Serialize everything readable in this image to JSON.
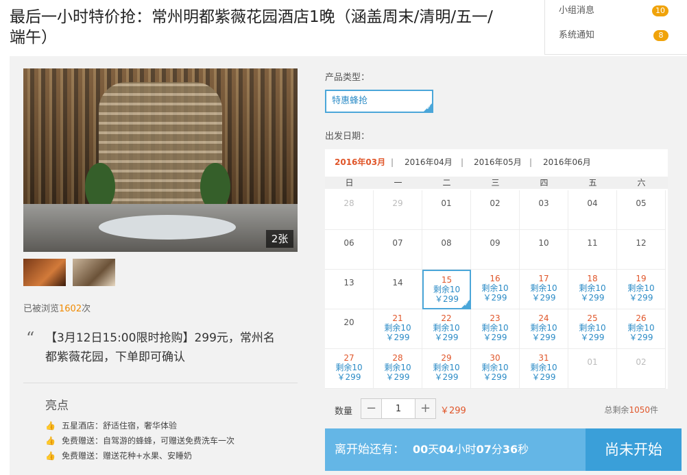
{
  "page": {
    "title": "最后一小时特价抢：常州明都紫薇花园酒店1晚（涵盖周末/清明/五一/端午）"
  },
  "notifications": [
    {
      "label": "小组消息",
      "count": "10"
    },
    {
      "label": "系统通知",
      "count": "8"
    }
  ],
  "gallery": {
    "count_label": "2张",
    "views_prefix": "已被浏览",
    "views_count": "1602",
    "views_suffix": "次"
  },
  "promo": {
    "text": "【3月12日15:00限时抢购】299元，常州名都紫薇花园，下单即可确认"
  },
  "highlights": {
    "title": "亮点",
    "items": [
      "五星酒店：舒适住宿，奢华体验",
      "免费赠送：自驾游的蜂蜂，可赠送免费洗车一次",
      "免费赠送：赠送花种+水果、安睡奶"
    ]
  },
  "product": {
    "type_label": "产品类型：",
    "type_value": "特惠蜂抢",
    "date_label": "出发日期："
  },
  "calendar": {
    "months": [
      "2016年03月",
      "2016年04月",
      "2016年05月",
      "2016年06月"
    ],
    "separator": "|",
    "weekdays": [
      "日",
      "一",
      "二",
      "三",
      "四",
      "五",
      "六"
    ],
    "weeks": [
      [
        {
          "d": "28",
          "muted": true
        },
        {
          "d": "29",
          "muted": true
        },
        {
          "d": "01"
        },
        {
          "d": "02"
        },
        {
          "d": "03"
        },
        {
          "d": "04"
        },
        {
          "d": "05"
        }
      ],
      [
        {
          "d": "06"
        },
        {
          "d": "07"
        },
        {
          "d": "08"
        },
        {
          "d": "09"
        },
        {
          "d": "10"
        },
        {
          "d": "11"
        },
        {
          "d": "12"
        }
      ],
      [
        {
          "d": "13"
        },
        {
          "d": "14"
        },
        {
          "d": "15",
          "stock": "剩余10",
          "price": "￥299",
          "selected": true
        },
        {
          "d": "16",
          "stock": "剩余10",
          "price": "￥299"
        },
        {
          "d": "17",
          "stock": "剩余10",
          "price": "￥299"
        },
        {
          "d": "18",
          "stock": "剩余10",
          "price": "￥299"
        },
        {
          "d": "19",
          "stock": "剩余10",
          "price": "￥299"
        }
      ],
      [
        {
          "d": "20"
        },
        {
          "d": "21",
          "stock": "剩余10",
          "price": "￥299"
        },
        {
          "d": "22",
          "stock": "剩余10",
          "price": "￥299"
        },
        {
          "d": "23",
          "stock": "剩余10",
          "price": "￥299"
        },
        {
          "d": "24",
          "stock": "剩余10",
          "price": "￥299"
        },
        {
          "d": "25",
          "stock": "剩余10",
          "price": "￥299"
        },
        {
          "d": "26",
          "stock": "剩余10",
          "price": "￥299"
        }
      ],
      [
        {
          "d": "27",
          "stock": "剩余10",
          "price": "￥299"
        },
        {
          "d": "28",
          "stock": "剩余10",
          "price": "￥299"
        },
        {
          "d": "29",
          "stock": "剩余10",
          "price": "￥299"
        },
        {
          "d": "30",
          "stock": "剩余10",
          "price": "￥299"
        },
        {
          "d": "31",
          "stock": "剩余10",
          "price": "￥299"
        },
        {
          "d": "01",
          "muted": true
        },
        {
          "d": "02",
          "muted": true
        }
      ]
    ]
  },
  "order": {
    "qty_label": "数量",
    "qty_value": "1",
    "minus": "−",
    "plus": "+",
    "unit_price": "￥299",
    "remain_prefix": "总剩余",
    "remain_count": "1050",
    "remain_suffix": "件"
  },
  "countdown": {
    "prefix": "离开始还有：",
    "days": "00",
    "days_unit": "天",
    "hours": "04",
    "hours_unit": "小时",
    "minutes": "07",
    "minutes_unit": "分",
    "seconds": "36",
    "seconds_unit": "秒",
    "status": "尚未开始"
  },
  "colors": {
    "accent": "#64b6e6",
    "highlight": "#e0562a",
    "badge": "#f0a30a"
  }
}
